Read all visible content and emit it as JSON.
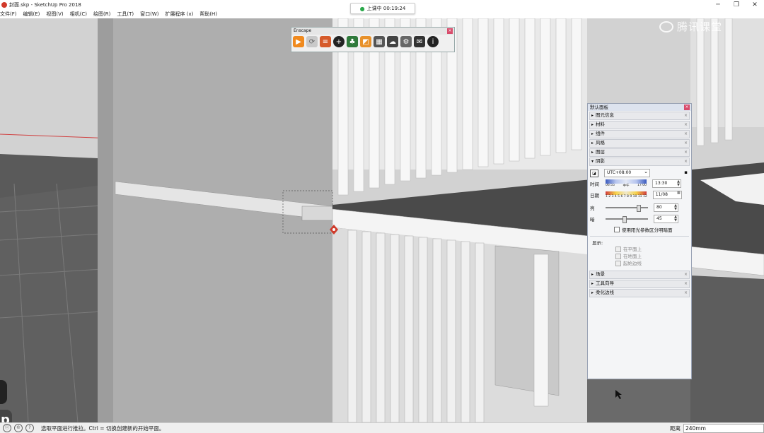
{
  "window": {
    "title": "封面.skp - SketchUp Pro 2018",
    "controls": [
      "─",
      "❐",
      "✕"
    ]
  },
  "menu": [
    "文件(F)",
    "编辑(E)",
    "视图(V)",
    "相机(C)",
    "绘图(R)",
    "工具(T)",
    "窗口(W)",
    "扩展程序 (x)",
    "帮助(H)"
  ],
  "live_timer": {
    "label": "上课中 00:19:24"
  },
  "watermark": {
    "text": "腾讯课堂"
  },
  "enscape_toolbar": {
    "title": "Enscape",
    "close": "×"
  },
  "default_tray": {
    "title": "默认面板",
    "close": "×",
    "sections_top": [
      "图元信息",
      "材料",
      "组件",
      "风格",
      "图层"
    ],
    "shadow_section": {
      "label": "阴影",
      "timezone": "UTC+08:00",
      "time_label": "时间",
      "time_start": "06:55",
      "time_mid": "中午",
      "time_end": "17:00",
      "time_value": "13:30",
      "date_label": "日期",
      "months": "1 2 3 4 5 6 7 8 9 10 11 12",
      "date_value": "11/08",
      "light_label": "亮",
      "light_value": "80",
      "dark_label": "暗",
      "dark_value": "45",
      "use_sun_label": "使用阳光参数区分明暗面",
      "display_label": "显示:",
      "display_options": [
        "在平面上",
        "在地面上",
        "起始边线"
      ]
    },
    "sections_bottom": [
      "场景",
      "工具向导",
      "柔化边线"
    ]
  },
  "status": {
    "message": "选取平面进行推拉。Ctrl = 切换创建新的开始平面。",
    "measure_label": "距离",
    "measure_value": "240mm"
  }
}
